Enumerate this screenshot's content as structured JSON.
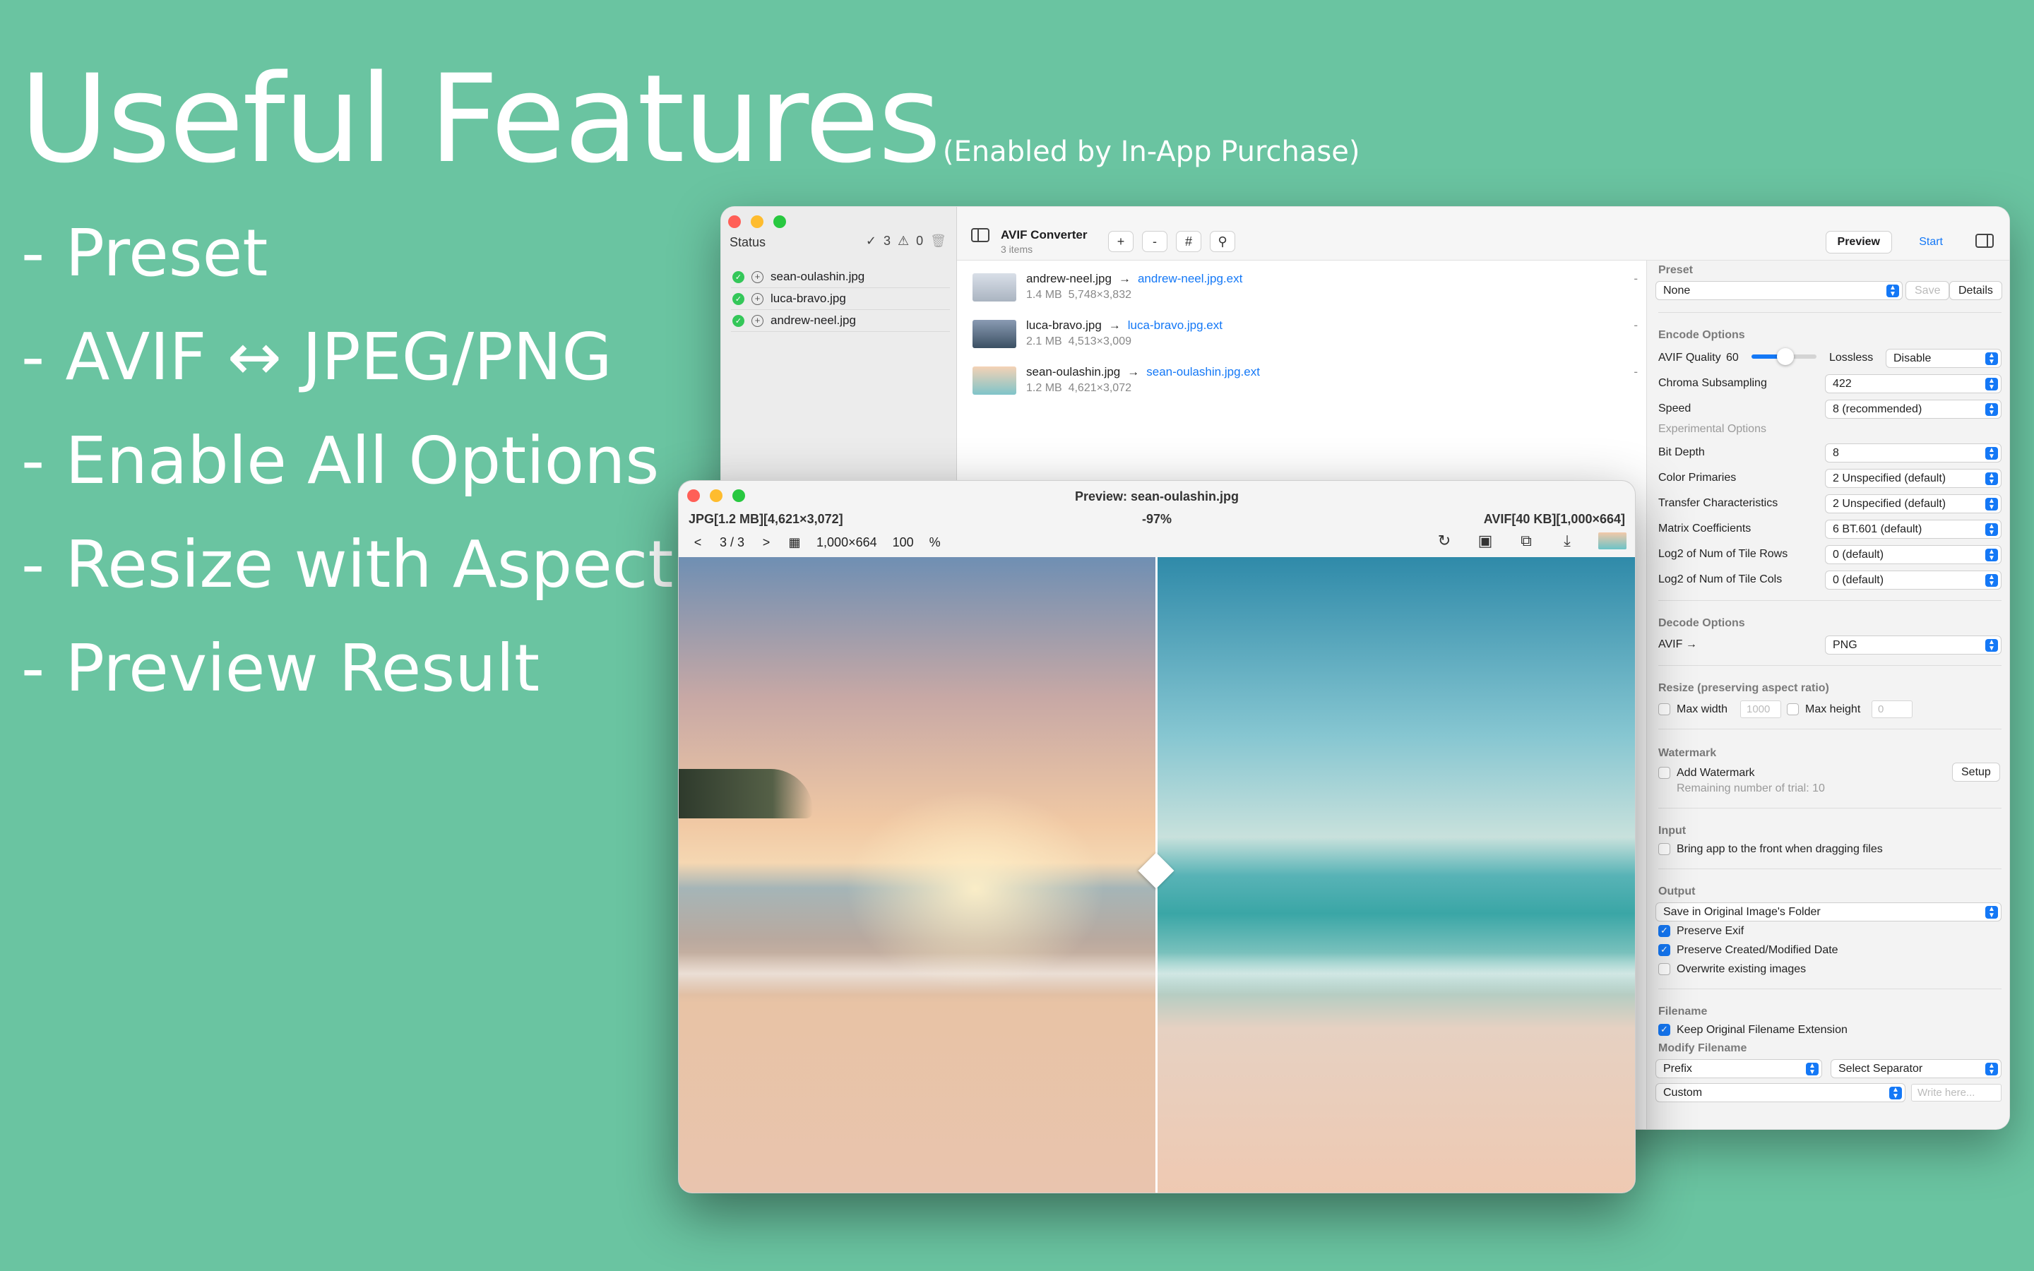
{
  "hero": {
    "title": "Useful Features",
    "subtitle": "(Enabled by In-App Purchase)"
  },
  "features": [
    "- Preset",
    "- AVIF ↔ JPEG/PNG",
    "- Enable All Options",
    "- Resize with Aspect",
    "- Preview Result"
  ],
  "main_window": {
    "sidebar": {
      "status_label": "Status",
      "ok_count": "3",
      "warn_count": "0",
      "items": [
        "sean-oulashin.jpg",
        "luca-bravo.jpg",
        "andrew-neel.jpg"
      ]
    },
    "toolbar": {
      "title": "AVIF Converter",
      "subtitle": "3 items",
      "add": "+",
      "remove": "-",
      "hash": "#",
      "preview": "Preview",
      "start": "Start"
    },
    "files": [
      {
        "name": "andrew-neel.jpg",
        "output": "andrew-neel.jpg.ext",
        "size": "1.4 MB",
        "dims": "5,748×3,832"
      },
      {
        "name": "luca-bravo.jpg",
        "output": "luca-bravo.jpg.ext",
        "size": "2.1 MB",
        "dims": "4,513×3,009"
      },
      {
        "name": "sean-oulashin.jpg",
        "output": "sean-oulashin.jpg.ext",
        "size": "1.2 MB",
        "dims": "4,621×3,072"
      }
    ],
    "inspector": {
      "preset_h": "Preset",
      "preset_value": "None",
      "save": "Save",
      "details": "Details",
      "encode_h": "Encode Options",
      "avif_quality_label": "AVIF Quality",
      "avif_quality_value": "60",
      "avif_quality_fraction": 0.52,
      "lossless_label": "Lossless",
      "lossless_value": "Disable",
      "chroma_label": "Chroma Subsampling",
      "chroma_value": "422",
      "speed_label": "Speed",
      "speed_value": "8 (recommended)",
      "experimental": "Experimental Options",
      "bitdepth_label": "Bit Depth",
      "bitdepth_value": "8",
      "primaries_label": "Color Primaries",
      "primaries_value": "2  Unspecified (default)",
      "transfer_label": "Transfer Characteristics",
      "transfer_value": "2  Unspecified (default)",
      "matrix_label": "Matrix Coefficients",
      "matrix_value": "6  BT.601 (default)",
      "tilerows_label": "Log2 of Num of Tile Rows",
      "tilerows_value": "0 (default)",
      "tilecols_label": "Log2 of Num of Tile Cols",
      "tilecols_value": "0 (default)",
      "decode_h": "Decode Options",
      "decode_label": "AVIF  →",
      "decode_value": "PNG",
      "resize_h": "Resize (preserving aspect ratio)",
      "maxw_label": "Max width",
      "maxw_placeholder": "1000",
      "maxh_label": "Max height",
      "maxh_placeholder": "0",
      "watermark_h": "Watermark",
      "add_watermark": "Add Watermark",
      "trial": "Remaining number of trial: 10",
      "setup": "Setup",
      "input_h": "Input",
      "bring_front": "Bring app to the front when dragging files",
      "output_h": "Output",
      "output_value": "Save in Original Image's Folder",
      "preserve_exif": "Preserve Exif",
      "preserve_date": "Preserve Created/Modified Date",
      "overwrite": "Overwrite existing images",
      "filename_h": "Filename",
      "keep_ext": "Keep Original Filename Extension",
      "modify_h": "Modify Filename",
      "prefix_value": "Prefix",
      "separator_value": "Select Separator",
      "custom_value": "Custom",
      "write_placeholder": "Write here..."
    }
  },
  "preview_window": {
    "title": "Preview: sean-oulashin.jpg",
    "left_info": "JPG[1.2 MB][4,621×3,072]",
    "ratio": "-97%",
    "right_info": "AVIF[40 KB][1,000×664]",
    "prev": "<",
    "page": "3 / 3",
    "next": ">",
    "dims": "1,000×664",
    "zoom": "100",
    "percent": "%"
  }
}
